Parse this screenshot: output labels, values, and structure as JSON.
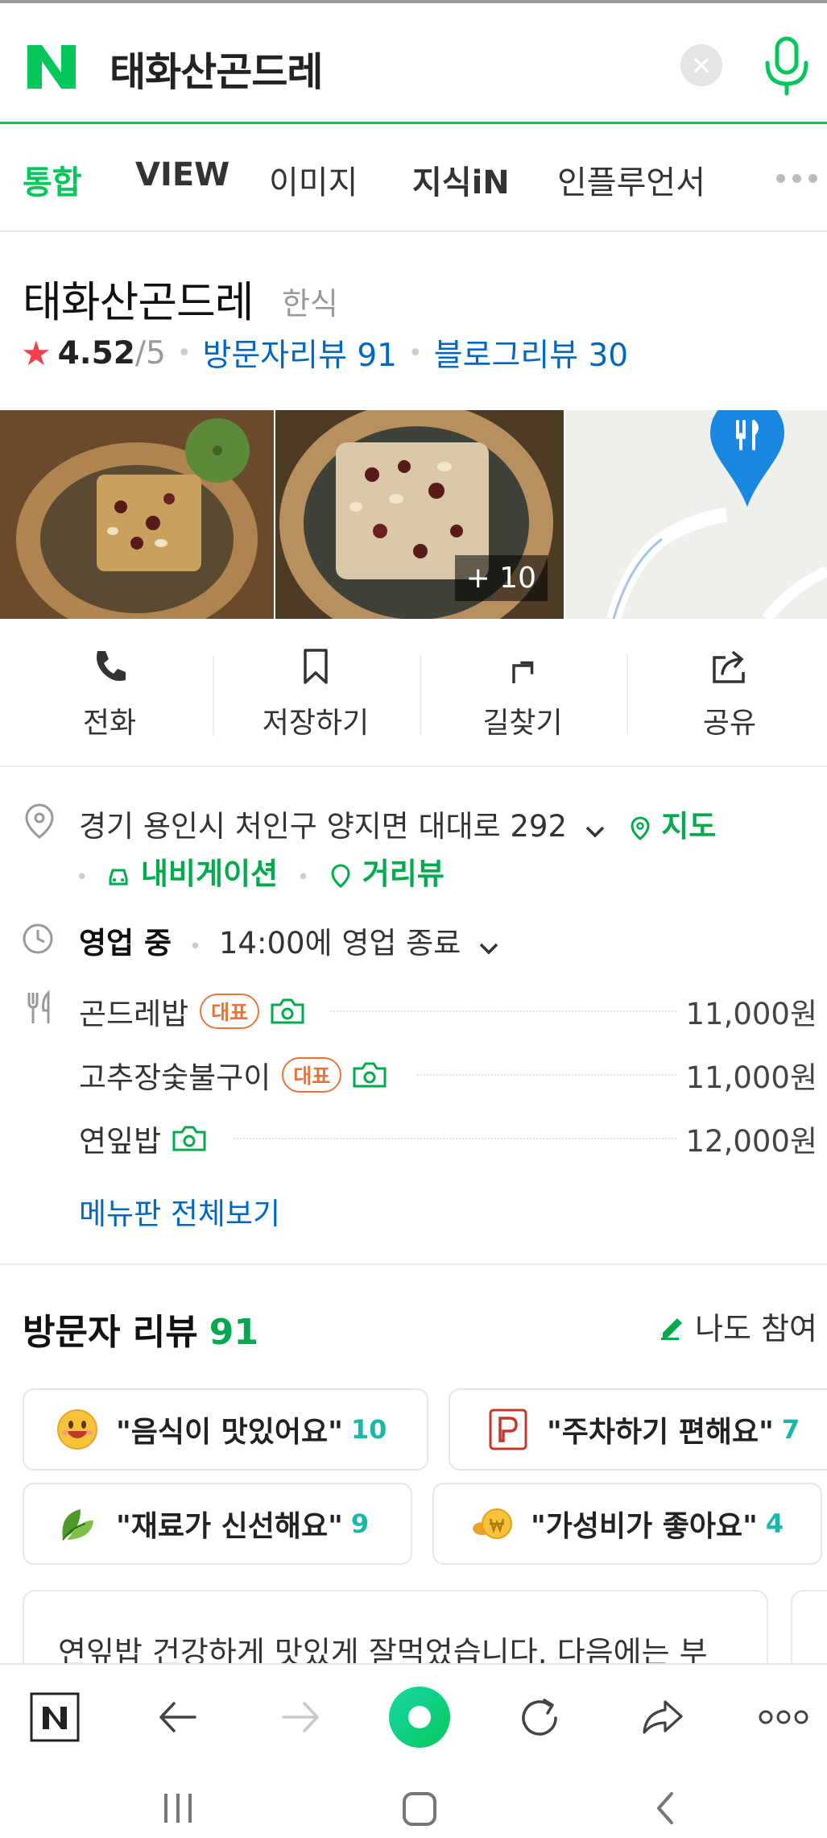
{
  "search": {
    "query": "태화산곤드레"
  },
  "tabs": [
    {
      "label": "통합"
    },
    {
      "label": "VIEW"
    },
    {
      "label": "이미지"
    },
    {
      "label": "지식iN"
    },
    {
      "label": "인플루언서"
    }
  ],
  "place": {
    "name": "태화산곤드레",
    "category": "한식",
    "rating": "4.52",
    "rating_max": "/5",
    "visitor_reviews": "방문자리뷰 91",
    "blog_reviews": "블로그리뷰 30"
  },
  "photos": {
    "more_label": "+ 10"
  },
  "actions": [
    {
      "label": "전화",
      "icon": "phone-icon"
    },
    {
      "label": "저장하기",
      "icon": "bookmark-icon"
    },
    {
      "label": "길찾기",
      "icon": "directions-icon"
    },
    {
      "label": "공유",
      "icon": "share-icon"
    }
  ],
  "info": {
    "address": "경기 용인시 처인구 양지면 대대로 292",
    "map_link": "지도",
    "navigation_link": "내비게이션",
    "streetview_link": "거리뷰",
    "status": "영업 중",
    "hours": "14:00에 영업 종료"
  },
  "menu": {
    "items": [
      {
        "name": "곤드레밥",
        "badge": "대표",
        "price": "11,000원"
      },
      {
        "name": "고추장숯불구이",
        "badge": "대표",
        "price": "11,000원"
      },
      {
        "name": "연잎밥",
        "badge": "",
        "price": "12,000원"
      }
    ],
    "view_all": "메뉴판 전체보기"
  },
  "reviews": {
    "title": "방문자 리뷰",
    "count": "91",
    "join": "나도 참여",
    "keywords": [
      {
        "text": "\"음식이 맛있어요\"",
        "count": "10",
        "icon": "smile-emoji-icon"
      },
      {
        "text": "\"주차하기 편해요\"",
        "count": "7",
        "icon": "parking-icon"
      },
      {
        "text": "\"재료가 신선해요\"",
        "count": "9",
        "icon": "leaf-icon"
      },
      {
        "text": "\"가성비가 좋아요\"",
        "count": "4",
        "icon": "coin-icon"
      }
    ],
    "first_review": "연잎밥 건강하게 맛있게 잘먹었습니다. 다음에는 부"
  },
  "colors": {
    "naver_green": "#03c75a",
    "link_blue": "#0068c3",
    "star_red": "#f2404f",
    "badge_orange": "#e8743b"
  }
}
